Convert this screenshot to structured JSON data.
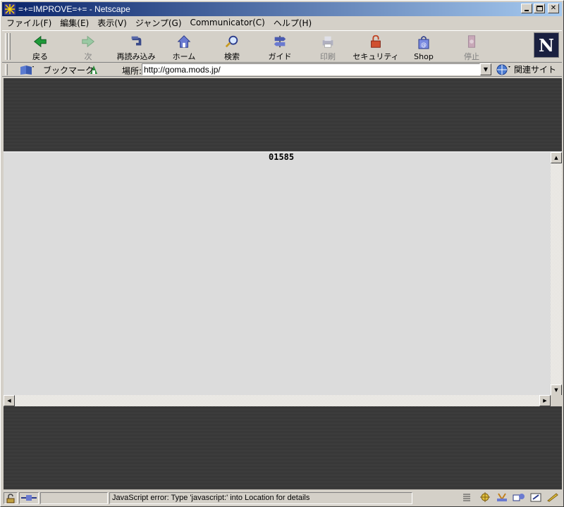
{
  "window": {
    "title": "=+=IMPROVE=+= - Netscape"
  },
  "menu": {
    "items": [
      {
        "label": "ファイル(F)"
      },
      {
        "label": "編集(E)"
      },
      {
        "label": "表示(V)"
      },
      {
        "label": "ジャンプ(G)"
      },
      {
        "label": "Communicator(C)"
      },
      {
        "label": "ヘルプ(H)"
      }
    ]
  },
  "toolbar": {
    "back": "戻る",
    "forward": "次",
    "reload": "再読み込み",
    "home": "ホーム",
    "search": "検索",
    "guide": "ガイド",
    "print": "印刷",
    "security": "セキュリティ",
    "shop": "Shop",
    "stop": "停止",
    "logo": "N"
  },
  "location": {
    "bookmarks_label": "ブックマーク",
    "location_label": "場所:",
    "url": "http://goma.mods.jp/",
    "related_label": "関連サイト"
  },
  "content": {
    "counter": "01585"
  },
  "status": {
    "message": "JavaScript error: Type 'javascript:' into Location for details"
  },
  "colors": {
    "titlebar_start": "#0a246a",
    "titlebar_end": "#a6caf0",
    "chrome": "#d4d0c8",
    "page_bg": "#3a3a3a",
    "frame_bg": "#dcdcdc"
  }
}
